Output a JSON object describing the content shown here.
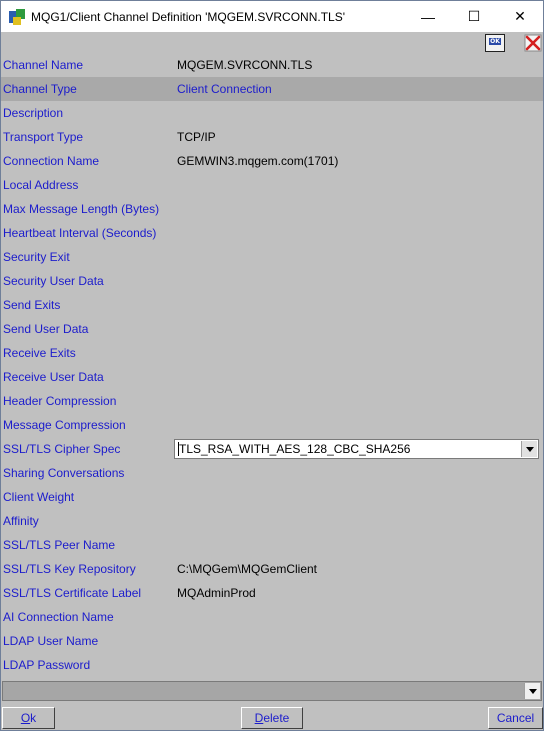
{
  "window": {
    "title": "MQG1/Client Channel Definition 'MQGEM.SVRCONN.TLS'",
    "controls": {
      "minimize": "—",
      "maximize": "☐",
      "close": "✕"
    }
  },
  "toolbar": {
    "ok_icon_text": "OK"
  },
  "fields": [
    {
      "label": "Channel Name",
      "value": "MQGEM.SVRCONN.TLS"
    },
    {
      "label": "Channel Type",
      "value": "Client Connection",
      "selected": true
    },
    {
      "label": "Description",
      "value": ""
    },
    {
      "label": "Transport Type",
      "value": "TCP/IP"
    },
    {
      "label": "Connection Name",
      "value": "GEMWIN3.mqgem.com(1701)"
    },
    {
      "label": "Local Address",
      "value": ""
    },
    {
      "label": "Max Message Length (Bytes)",
      "value": ""
    },
    {
      "label": "Heartbeat Interval (Seconds)",
      "value": ""
    },
    {
      "label": "Security Exit",
      "value": ""
    },
    {
      "label": "Security User Data",
      "value": ""
    },
    {
      "label": "Send Exits",
      "value": ""
    },
    {
      "label": "Send User Data",
      "value": ""
    },
    {
      "label": "Receive Exits",
      "value": ""
    },
    {
      "label": "Receive User Data",
      "value": ""
    },
    {
      "label": "Header Compression",
      "value": ""
    },
    {
      "label": "Message Compression",
      "value": ""
    },
    {
      "label": "SSL/TLS Cipher Spec",
      "value": "TLS_RSA_WITH_AES_128_CBC_SHA256"
    },
    {
      "label": "Sharing Conversations",
      "value": ""
    },
    {
      "label": "Client Weight",
      "value": ""
    },
    {
      "label": "Affinity",
      "value": ""
    },
    {
      "label": "SSL/TLS Peer Name",
      "value": ""
    },
    {
      "label": "SSL/TLS Key Repository",
      "value": "C:\\MQGem\\MQGemClient"
    },
    {
      "label": "SSL/TLS Certificate Label",
      "value": "MQAdminProd"
    },
    {
      "label": "AI Connection Name",
      "value": ""
    },
    {
      "label": "LDAP User Name",
      "value": ""
    },
    {
      "label": "LDAP Password",
      "value": ""
    }
  ],
  "bottom_combo": {
    "value": ""
  },
  "buttons": {
    "ok": {
      "mnemonic": "O",
      "rest": "k"
    },
    "delete": {
      "mnemonic": "D",
      "rest": "elete"
    },
    "cancel": {
      "mnemonic": "",
      "rest": "Cancel"
    }
  },
  "colors": {
    "label": "#1c1ccc",
    "background": "#c0c0c0",
    "selected_row": "#a9a9a9"
  }
}
